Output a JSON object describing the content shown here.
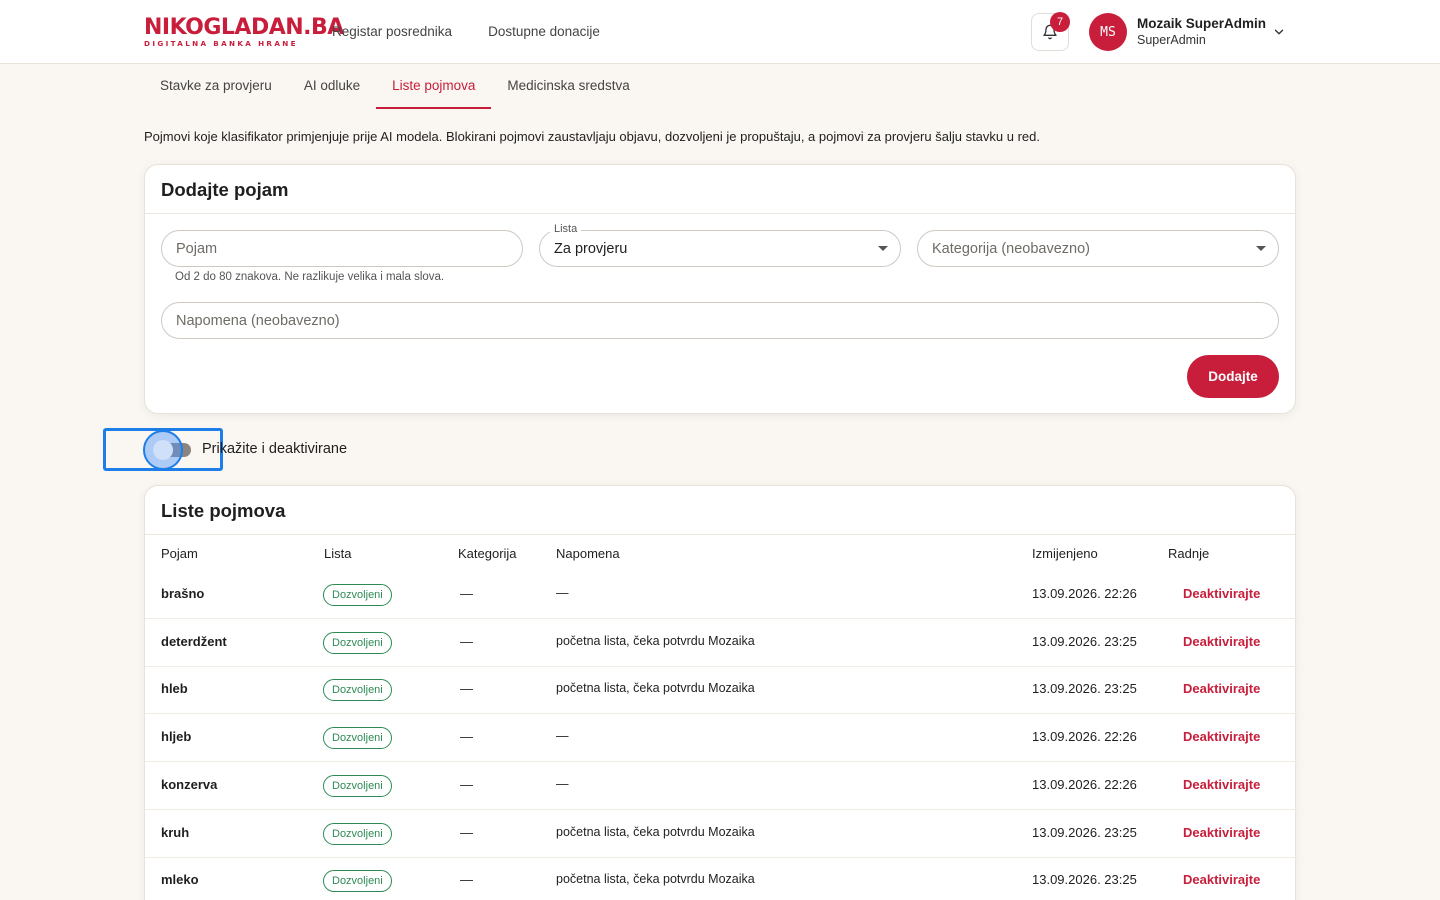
{
  "header": {
    "logo_main": "NIKOGLADAN.BA",
    "logo_sub": "DIGITALNA BANKA HRANE",
    "nav": [
      "Registar posrednika",
      "Dostupne donacije"
    ],
    "notification_count": "7",
    "user": {
      "initials": "MS",
      "name": "Mozaik SuperAdmin",
      "role": "SuperAdmin"
    }
  },
  "tabs": [
    {
      "label": "Stavke za provjeru",
      "active": false
    },
    {
      "label": "AI odluke",
      "active": false
    },
    {
      "label": "Liste pojmova",
      "active": true
    },
    {
      "label": "Medicinska sredstva",
      "active": false
    }
  ],
  "intro": "Pojmovi koje klasifikator primjenjuje prije AI modela. Blokirani pojmovi zaustavljaju objavu, dozvoljeni je propuštaju, a pojmovi za provjeru šalju stavku u red.",
  "add_form": {
    "title": "Dodajte pojam",
    "term_placeholder": "Pojam",
    "term_help": "Od 2 do 80 znakova. Ne razlikuje velika i mala slova.",
    "list_label": "Lista",
    "list_value": "Za provjeru",
    "category_placeholder": "Kategorija (neobavezno)",
    "note_placeholder": "Napomena (neobavezno)",
    "submit_label": "Dodajte"
  },
  "toggle": {
    "label": "Prikažite i deaktivirane",
    "on": false
  },
  "list": {
    "title": "Liste pojmova",
    "columns": [
      "Pojam",
      "Lista",
      "Kategorija",
      "Napomena",
      "Izmijenjeno",
      "Radnje"
    ],
    "rows": [
      {
        "term": "brašno",
        "list": "Dozvoljeni",
        "category": "—",
        "note": "—",
        "modified": "13.09.2026. 22:26",
        "action": "Deaktivirajte"
      },
      {
        "term": "deterdžent",
        "list": "Dozvoljeni",
        "category": "—",
        "note": "početna lista, čeka potvrdu Mozaika",
        "modified": "13.09.2026. 23:25",
        "action": "Deaktivirajte"
      },
      {
        "term": "hleb",
        "list": "Dozvoljeni",
        "category": "—",
        "note": "početna lista, čeka potvrdu Mozaika",
        "modified": "13.09.2026. 23:25",
        "action": "Deaktivirajte"
      },
      {
        "term": "hljeb",
        "list": "Dozvoljeni",
        "category": "—",
        "note": "—",
        "modified": "13.09.2026. 22:26",
        "action": "Deaktivirajte"
      },
      {
        "term": "konzerva",
        "list": "Dozvoljeni",
        "category": "—",
        "note": "—",
        "modified": "13.09.2026. 22:26",
        "action": "Deaktivirajte"
      },
      {
        "term": "kruh",
        "list": "Dozvoljeni",
        "category": "—",
        "note": "početna lista, čeka potvrdu Mozaika",
        "modified": "13.09.2026. 23:25",
        "action": "Deaktivirajte"
      },
      {
        "term": "mleko",
        "list": "Dozvoljeni",
        "category": "—",
        "note": "početna lista, čeka potvrdu Mozaika",
        "modified": "13.09.2026. 23:25",
        "action": "Deaktivirajte"
      }
    ]
  },
  "colors": {
    "accent": "#c81e3c",
    "badge_green": "#2e8a55",
    "focus_blue": "#1e7ee8",
    "background": "#faf6f1"
  }
}
